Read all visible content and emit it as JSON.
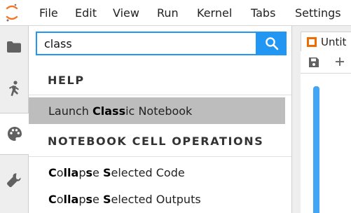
{
  "menubar": {
    "logo_icon": "jupyter-logo-icon",
    "items": [
      "File",
      "Edit",
      "View",
      "Run",
      "Kernel",
      "Tabs",
      "Settings"
    ]
  },
  "leftbar": {
    "tabs": [
      {
        "icon": "folder-icon"
      },
      {
        "icon": "running-icon"
      },
      {
        "icon": "palette-icon"
      },
      {
        "icon": "wrench-icon"
      }
    ]
  },
  "palette": {
    "search": {
      "value": "class"
    },
    "search_icon": "search-icon",
    "categories": [
      {
        "name": "HELP",
        "commands": [
          {
            "parts": [
              [
                "Launch ",
                false
              ],
              [
                "Class",
                true
              ],
              [
                "ic Notebook",
                false
              ]
            ]
          }
        ]
      },
      {
        "name": "NOTEBOOK CELL OPERATIONS",
        "commands": [
          {
            "parts": [
              [
                "C",
                true
              ],
              [
                "o",
                false
              ],
              [
                "lla",
                true
              ],
              [
                "p",
                false
              ],
              [
                "s",
                true
              ],
              [
                "e ",
                false
              ],
              [
                "S",
                true
              ],
              [
                "elected Code",
                false
              ]
            ]
          },
          {
            "parts": [
              [
                "C",
                true
              ],
              [
                "o",
                false
              ],
              [
                "lla",
                true
              ],
              [
                "p",
                false
              ],
              [
                "s",
                true
              ],
              [
                "e ",
                false
              ],
              [
                "S",
                true
              ],
              [
                "elected Outputs",
                false
              ]
            ]
          }
        ]
      }
    ]
  },
  "main": {
    "doc_tab_label": "Untit",
    "toolbar_icons": [
      "save-icon",
      "add-icon"
    ]
  },
  "colors": {
    "accent": "#2196f3",
    "logo": "#f37626",
    "selected_row": "#bdbdbd"
  }
}
